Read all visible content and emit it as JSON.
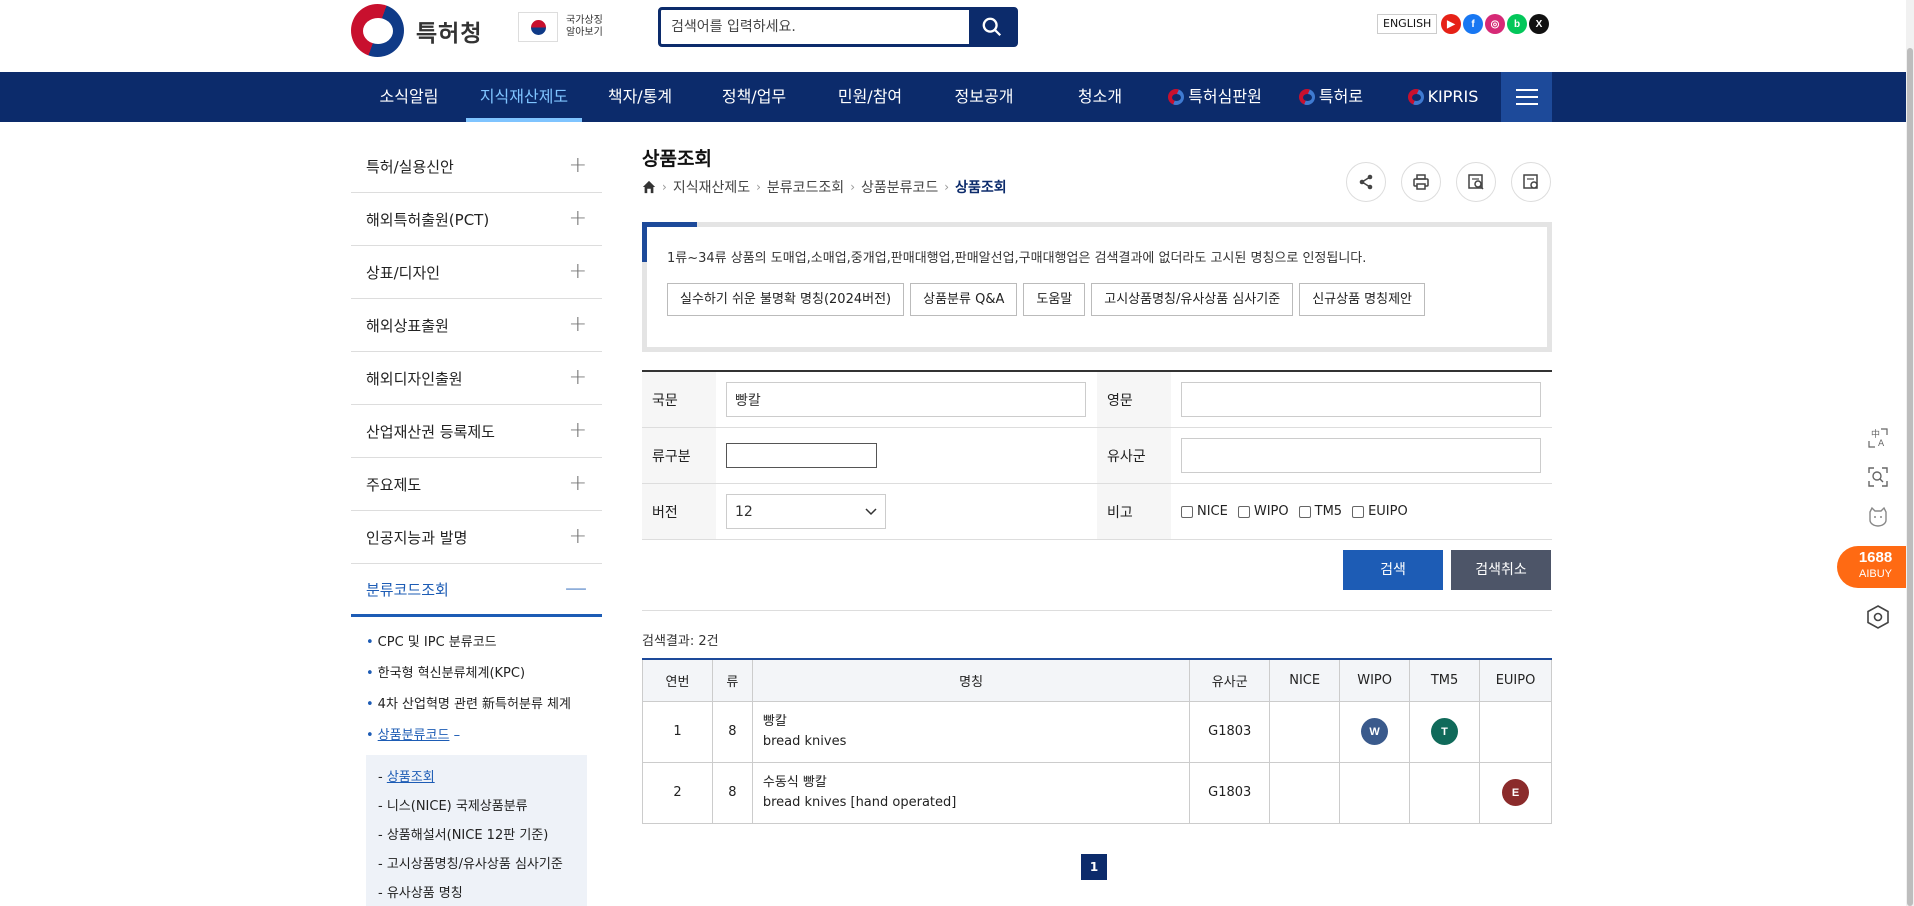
{
  "header": {
    "logo_text": "특허청",
    "national_symbol_text": "국가상징 알아보기",
    "search_placeholder": "검색어를 입력하세요.",
    "english_label": "ENGLISH",
    "socials": [
      {
        "name": "youtube",
        "color": "#e62117",
        "glyph": "▶"
      },
      {
        "name": "facebook",
        "color": "#1877f2",
        "glyph": "f"
      },
      {
        "name": "instagram",
        "color": "#d62976",
        "glyph": "◎"
      },
      {
        "name": "blog",
        "color": "#03c75a",
        "glyph": "b"
      },
      {
        "name": "x",
        "color": "#111111",
        "glyph": "X"
      }
    ]
  },
  "gnb": {
    "items": [
      "소식알림",
      "지식재산제도",
      "책자/통계",
      "정책/업무",
      "민원/참여",
      "정보공개",
      "청소개"
    ],
    "external": [
      "특허심판원",
      "특허로",
      "KIPRIS"
    ]
  },
  "sidebar": {
    "items": [
      "특허/실용신안",
      "해외특허출원(PCT)",
      "상표/디자인",
      "해외상표출원",
      "해외디자인출원",
      "산업재산권 등록제도",
      "주요제도",
      "인공지능과 발명"
    ],
    "active": "분류코드조회",
    "sub1": [
      "CPC 및 IPC 분류코드",
      "한국형 혁신분류체계(KPC)",
      "4차 산업혁명 관련 新특허분류 체계",
      "상품분류코드"
    ],
    "sub2": [
      "상품조회",
      "니스(NICE) 국제상품분류",
      "상품해설서(NICE 12판 기준)",
      "고시상품명칭/유사상품 심사기준",
      "유사상품 명칭"
    ]
  },
  "content": {
    "title": "상품조회",
    "breadcrumb": [
      "지식재산제도",
      "분류코드조회",
      "상품분류코드",
      "상품조회"
    ],
    "notice": "1류~34류 상품의 도매업,소매업,중개업,판매대행업,판매알선업,구매대행업은 검색결과에 없더라도 고시된 명칭으로 인정됩니다.",
    "notice_buttons": [
      "실수하기 쉬운 불명확 명칭(2024버전)",
      "상품분류 Q&A",
      "도움말",
      "고시상품명칭/유사상품 심사기준",
      "신규상품 명칭제안"
    ]
  },
  "form": {
    "korean_label": "국문",
    "korean_value": "빵칼",
    "english_label": "영문",
    "english_value": "",
    "class_label": "류구분",
    "class_value": "",
    "similar_label": "유사군",
    "similar_value": "",
    "version_label": "버전",
    "version_value": "12",
    "remark_label": "비고",
    "checkboxes": [
      "NICE",
      "WIPO",
      "TM5",
      "EUIPO"
    ],
    "search_button": "검색",
    "cancel_button": "검색취소"
  },
  "results": {
    "count_text": "검색결과: 2건",
    "headers": [
      "연번",
      "류",
      "명칭",
      "유사군",
      "NICE",
      "WIPO",
      "TM5",
      "EUIPO"
    ],
    "rows": [
      {
        "no": "1",
        "cls": "8",
        "name_ko": "빵칼",
        "name_en": "bread knives",
        "similar": "G1803",
        "nice": "",
        "wipo": "W",
        "tm5": "T",
        "euipo": ""
      },
      {
        "no": "2",
        "cls": "8",
        "name_ko": "수동식 빵칼",
        "name_en": "bread knives [hand operated]",
        "similar": "G1803",
        "nice": "",
        "wipo": "",
        "tm5": "",
        "euipo": "E"
      }
    ],
    "badge_colors": {
      "wipo": "#3a5a8c",
      "tm5": "#106a5a",
      "euipo": "#8b2b2b"
    }
  },
  "pagination": {
    "current": "1"
  },
  "floating": {
    "aibuy_number": "1688",
    "aibuy_label": "AIBUY",
    "icons": [
      "translate-icon",
      "screen-search-icon",
      "ai-cat-icon"
    ]
  }
}
